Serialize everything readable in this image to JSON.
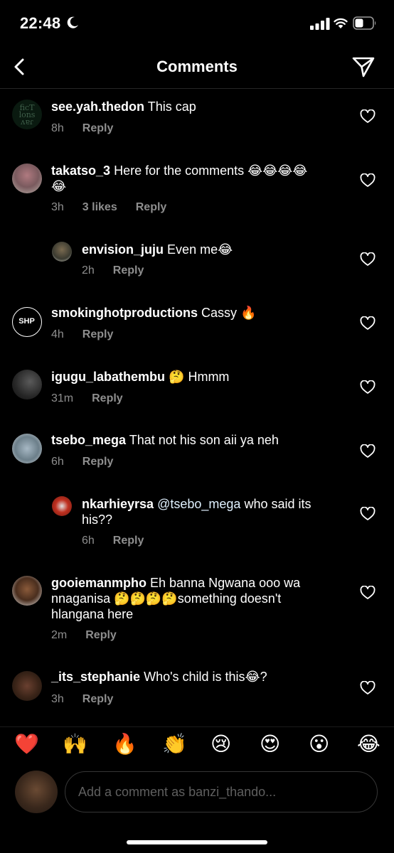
{
  "status": {
    "time": "22:48"
  },
  "header": {
    "title": "Comments"
  },
  "comments": [
    {
      "username": "see.yah.thedon",
      "text": "This cap",
      "time": "8h",
      "likes": "",
      "reply": "Reply"
    },
    {
      "username": "takatso_3",
      "text": "Here for the comments 😂😂😂😂",
      "text2": "😂",
      "time": "3h",
      "likes": "3 likes",
      "reply": "Reply"
    },
    {
      "username": "envision_juju",
      "text": "Even me😂",
      "time": "2h",
      "likes": "",
      "reply": "Reply"
    },
    {
      "username": "smokinghotproductions",
      "text": "Cassy 🔥",
      "time": "4h",
      "likes": "",
      "reply": "Reply",
      "avatar_text": "SHP"
    },
    {
      "username": "igugu_labathembu",
      "text": "🤔 Hmmm",
      "time": "31m",
      "likes": "",
      "reply": "Reply"
    },
    {
      "username": "tsebo_mega",
      "text": "That not his son aii ya neh",
      "time": "6h",
      "likes": "",
      "reply": "Reply"
    },
    {
      "username": "nkarhieyrsa",
      "mention": "@tsebo_mega",
      "text": "who said its",
      "text2": "his??",
      "time": "6h",
      "likes": "",
      "reply": "Reply"
    },
    {
      "username": "gooiemanmpho",
      "text": "Eh banna Ngwana ooo wa",
      "text2": "nnaganisa 🤔🤔🤔🤔something doesn't",
      "text3": "hlangana here",
      "time": "2m",
      "likes": "",
      "reply": "Reply"
    },
    {
      "username": "_its_stephanie",
      "text": "Who's child is this😂?",
      "time": "3h",
      "likes": "",
      "reply": "Reply"
    }
  ],
  "emoji_bar": [
    "❤️",
    "🙌",
    "🔥",
    "👏",
    "😢",
    "😍",
    "😮",
    "😂"
  ],
  "composer": {
    "placeholder": "Add a comment as banzi_thando..."
  },
  "colors": {
    "background": "#000000",
    "secondary_text": "#8e8e8e",
    "divider": "#262626"
  }
}
